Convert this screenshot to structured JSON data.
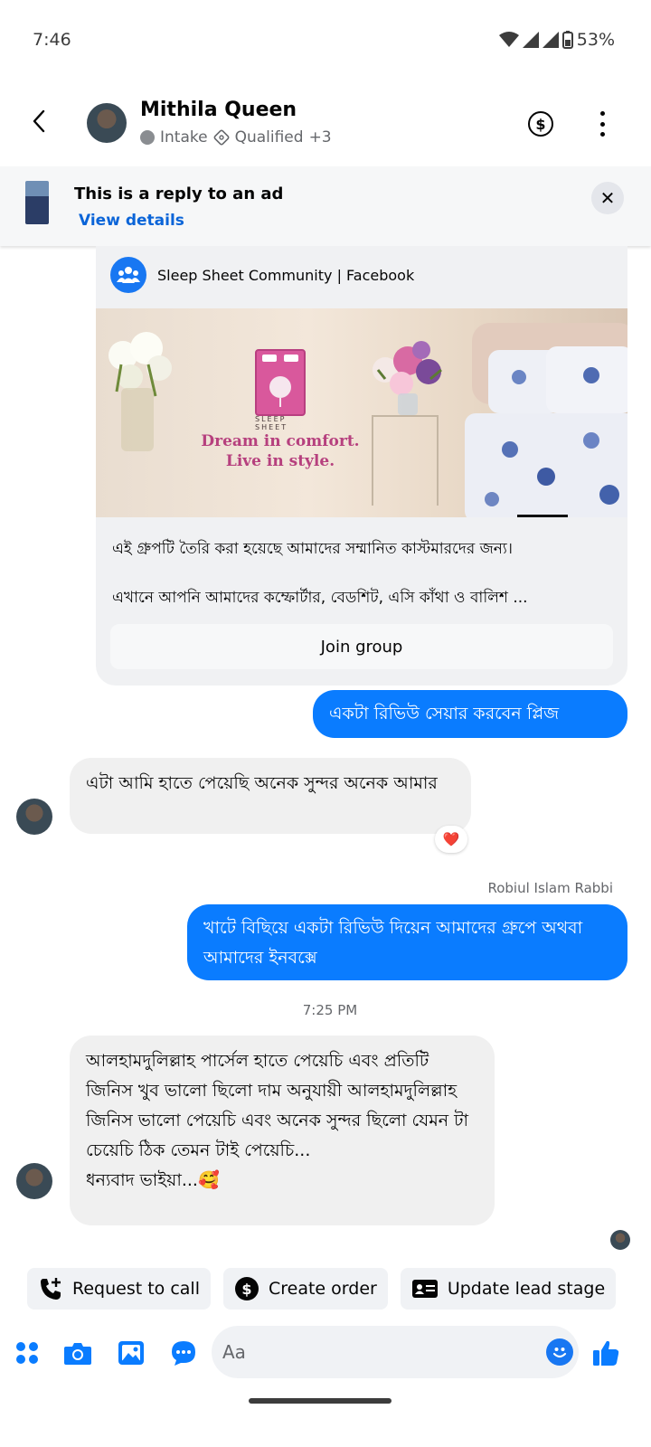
{
  "status": {
    "time": "7:46",
    "battery": "53%"
  },
  "header": {
    "name": "Mithila Queen",
    "stage": "Intake",
    "label": "Qualified",
    "more_count": "+3",
    "dollar_symbol": "$"
  },
  "ad_banner": {
    "title": "This is a reply to an ad",
    "link": "View details",
    "close": "✕"
  },
  "ad_card": {
    "group_name": "Sleep Sheet Community | Facebook",
    "image_logo_text": "SLEEP SHEET",
    "image_headline": "Dream in comfort. Live in style.",
    "body_line1": "এই গ্রুপটি তৈরি করা হয়েছে আমাদের সম্মানিত কাস্টমারদের জন্য।",
    "body_line2": "এখানে আপনি আমাদের কম্ফোর্টার, বেডশিট, এসি কাঁথা ও বালিশ ...",
    "join_button": "Join group"
  },
  "messages": [
    {
      "direction": "out",
      "text": "একটা রিভিউ সেয়ার করবেন প্লিজ"
    },
    {
      "direction": "in",
      "text": "এটা আমি হাতে পেয়েছি অনেক সুন্দর অনেক আমার",
      "reaction": "❤️"
    },
    {
      "direction": "out",
      "sender": "Robiul Islam Rabbi",
      "text": "খাটে বিছিয়ে একটা রিভিউ দিয়েন আমাদের গ্রুপে অথবা আমাদের ইনবক্সে"
    },
    {
      "timestamp": "7:25 PM"
    },
    {
      "direction": "in",
      "text": "আলহামদুলিল্লাহ পার্সেল হাতে পেয়েচি এবং প্রতিটি জিনিস খুব ভালো ছিলো দাম অনুযায়ী আলহামদুলিল্লাহ জিনিস ভালো পেয়েচি এবং অনেক সুন্দর ছিলো যেমন টা চেয়েচি ঠিক তেমন টাই পেয়েচি...\nধন্যবাদ ভাইয়া...🥰"
    }
  ],
  "quick_actions": [
    "Request to call",
    "Create order",
    "Update lead stage"
  ],
  "composer": {
    "placeholder": "Aa"
  },
  "colors": {
    "accent": "#0a7cff",
    "link": "#0a64d8",
    "bubble_in": "#f0f0f0"
  }
}
